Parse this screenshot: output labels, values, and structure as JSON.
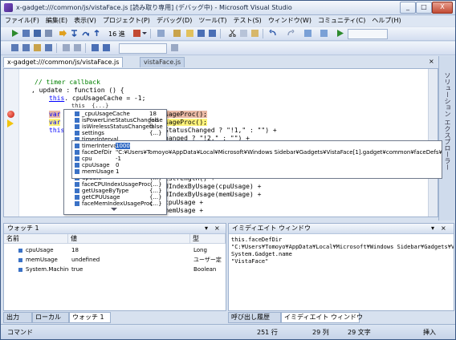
{
  "window": {
    "title": "x-gadget:///common/js/vistaFace.js [読み取り専用] (デバッグ中) - Microsoft Visual Studio",
    "controls": [
      "_",
      "□",
      "X"
    ]
  },
  "menu": [
    "ファイル(F)",
    "編集(E)",
    "表示(V)",
    "プロジェクト(P)",
    "デバッグ(D)",
    "ツール(T)",
    "テスト(S)",
    "ウィンドウ(W)",
    "コミュニティ(C)",
    "ヘルプ(H)"
  ],
  "toolbar": {
    "hex_label": "16 進"
  },
  "tabs": [
    {
      "label": "x-gadget:///common/js/vistaFace.js",
      "active": true
    },
    {
      "label": "vistaFace.js",
      "active": false
    }
  ],
  "side_panel": {
    "label": "ソリューション エクスプローラー"
  },
  "code": {
    "line1": "// timer callback",
    "line2": ", update : function () {",
    "line3a": "this",
    "line3b": ". cpuUsageCache = -1;",
    "line4": "this  {...}",
    "line5a": "var",
    "line5b": "sageProc();",
    "line6a": "var",
    "line6b": "sageProc();",
    "line7a": "this",
    "line7b": "StatusChanged ? \"!1,\" : \"\") +",
    "line8": "hanged ? \"!2,\" : \"\") +",
    "line9": "lStrength() +",
    "line10": "UIndexByUsage(cpuUsage) +",
    "line11": "UIndexByUsage(memUsage) +",
    "line12": "cpuUsage +",
    "line13": "memUsage +"
  },
  "tooltip": {
    "header": "this  {...}",
    "items": [
      {
        "name": "_cpuUsageCache",
        "value": "18"
      },
      {
        "name": "isPowerLineStatusChanged",
        "value": "false"
      },
      {
        "name": "isWirelessStatusChanged",
        "value": "false"
      },
      {
        "name": "settings",
        "value": "{...}"
      },
      {
        "name": "timerInterval",
        "value": "1000"
      },
      {
        "name": "faceDefDir",
        "value": ""
      },
      {
        "name": "cpu",
        "value": ""
      },
      {
        "name": "cpuUsage",
        "value": ""
      },
      {
        "name": "memUsage",
        "value": ""
      },
      {
        "name": "loadFaceDef",
        "value": ""
      },
      {
        "name": "update",
        "value": "{...}"
      },
      {
        "name": "faceCPUIndexUsageProc",
        "value": "{...}"
      },
      {
        "name": "getUsageByType",
        "value": "{...}"
      },
      {
        "name": "getCPUUsage",
        "value": "{...}"
      },
      {
        "name": "faceMemIndexUsageProc",
        "value": "{...}"
      }
    ]
  },
  "tooltip2": {
    "items": [
      {
        "name": "timerInterval",
        "value": "1000"
      },
      {
        "name": "faceDefDir",
        "value": "\"C:¥Users¥Tomoyo¥AppData¥Local¥Microsoft¥Windows Sidebar¥Gadgets¥VistaFace[1].gadget¥common¥faceDefs¥Untitled 300.mcface\""
      },
      {
        "name": "cpu",
        "value": "-1"
      },
      {
        "name": "cpuUsage",
        "value": "0"
      },
      {
        "name": "memUsage",
        "value": "1"
      }
    ]
  },
  "watch": {
    "title": "ウォッチ 1",
    "columns": [
      "名前",
      "値",
      "型"
    ],
    "rows": [
      {
        "name": "cpuUsage",
        "value": "18",
        "type": "Long"
      },
      {
        "name": "memUsage",
        "value": "undefined",
        "type": "ユーザー定"
      },
      {
        "name": "System.Machine.I",
        "value": "true",
        "type": "Boolean"
      }
    ]
  },
  "immediate": {
    "title": "イミディエイト ウィンドウ",
    "lines": [
      "this.faceDefDir",
      "\"C:¥Users¥Tomoyo¥AppData¥Local¥Microsoft¥Windows Sidebar¥Gadgets¥Vi",
      "System.Gadget.name",
      "\"VistaFace\""
    ]
  },
  "bottom_tabs_left": [
    "出力",
    "ローカル",
    "ウォッチ 1"
  ],
  "bottom_tabs_right": [
    "呼び出し履歴",
    "イミディエイト ウィンドウ"
  ],
  "status": {
    "mode": "コマンド",
    "line": "251 行",
    "col": "29 列",
    "ch": "29 文字",
    "ins": "挿入"
  }
}
